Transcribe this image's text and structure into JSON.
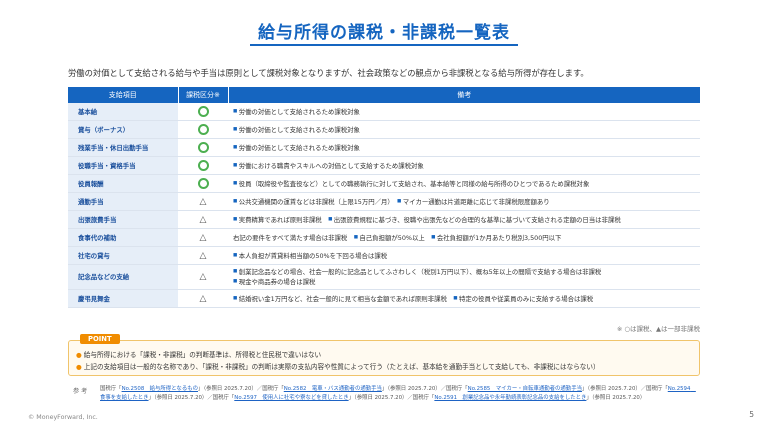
{
  "title": "給与所得の課税・非課税一覧表",
  "intro": "労働の対価として支給される給与や手当は原則として課税対象となりますが、社会政策などの観点から非課税となる給与所得が存在します。",
  "table": {
    "headers": [
      "支給項目",
      "課税区分※",
      "備考"
    ],
    "rows": [
      {
        "item": "基本給",
        "mark": "○",
        "notes": [
          "労働の対価として支給されるため課税対象"
        ]
      },
      {
        "item": "賞与（ボーナス）",
        "mark": "○",
        "notes": [
          "労働の対価として支給されるため課税対象"
        ]
      },
      {
        "item": "残業手当・休日出勤手当",
        "mark": "○",
        "notes": [
          "労働の対価として支給されるため課税対象"
        ]
      },
      {
        "item": "役職手当・資格手当",
        "mark": "○",
        "notes": [
          "労働における職責やスキルへの対価として支給するため課税対象"
        ]
      },
      {
        "item": "役員報酬",
        "mark": "○",
        "notes": [
          "役員（取締役や監査役など）としての職務執行に対して支給され、基本給等と同様の給与所得のひとつであるため課税対象"
        ]
      },
      {
        "item": "通勤手当",
        "mark": "△",
        "notes": [
          "公共交通機関の運賃などは非課税（上限15万円／月）",
          "マイカー通勤は片道距離に応じて非課税限度額あり"
        ]
      },
      {
        "item": "出張旅費手当",
        "mark": "△",
        "notes": [
          "実費精算であれば原則非課税",
          "出張旅費規程に基づき、役職や出張先などの合理的な基準に基づいて支給される定額の日当は非課税"
        ]
      },
      {
        "item": "食事代の補助",
        "mark": "△",
        "notes": [
          "右記の要件をすべて満たす場合は非課税",
          "自己負担額が50%以上",
          "会社負担額が1か月あたり税別3,500円以下"
        ]
      },
      {
        "item": "社宅の貸与",
        "mark": "△",
        "notes": [
          "本人負担が賃貸料相当額の50%を下回る場合は課税"
        ]
      },
      {
        "item": "記念品などの支給",
        "mark": "△",
        "notes": [
          "創業記念品などの場合、社会一般的に記念品としてふさわしく（税別1万円以下）、概ね5年以上の間隔で支給する場合は非課税",
          "現金や商品券の場合は課税"
        ],
        "tall": true
      },
      {
        "item": "慶弔見舞金",
        "mark": "△",
        "notes": [
          "結婚祝い金1万円など、社会一般的に見て相当な金額であれば原則非課税",
          "特定の役員や従業員のみに支給する場合は課税"
        ]
      }
    ]
  },
  "legend": "※ ○は課税、▲は一部非課税",
  "point": {
    "tag": "POINT",
    "lines": [
      "給与所得における「課税・非課税」の判断基準は、所得税と住民税で違いはない",
      "上記の支給項目は一般的な名称であり、「課税・非課税」の判断は実際の支払内容や性質によって行う（たとえば、基本給を通勤手当として支給しても、非課税にはならない）"
    ]
  },
  "references": {
    "label": "参 考",
    "entries": [
      {
        "prefix": "国税庁「",
        "link": "No.2508　給与所得となるもの",
        "suffix": "」（参照日 2025.7.20）／"
      },
      {
        "prefix": "国税庁「",
        "link": "No.2582　電車・バス通勤者の通勤手当",
        "suffix": "」（参照日 2025.7.20）／"
      },
      {
        "prefix": "国税庁「",
        "link": "No.2585　マイカー・自転車通勤者の通勤手当",
        "suffix": "」（参照日 2025.7.20）／"
      },
      {
        "prefix": "国税庁「",
        "link": "No.2594　食事を支給したとき",
        "suffix": "」（参照日 2025.7.20）／"
      },
      {
        "prefix": "国税庁「",
        "link": "No.2597　使用人に社宅や寮などを貸したとき",
        "suffix": "」（参照日 2025.7.20）／"
      },
      {
        "prefix": "国税庁「",
        "link": "No.2591　創業記念品や永年勤続表彰記念品の支給をしたとき",
        "suffix": "」（参照日 2025.7.20）"
      }
    ]
  },
  "footer": "© MoneyForward, Inc.",
  "page_number": "5"
}
